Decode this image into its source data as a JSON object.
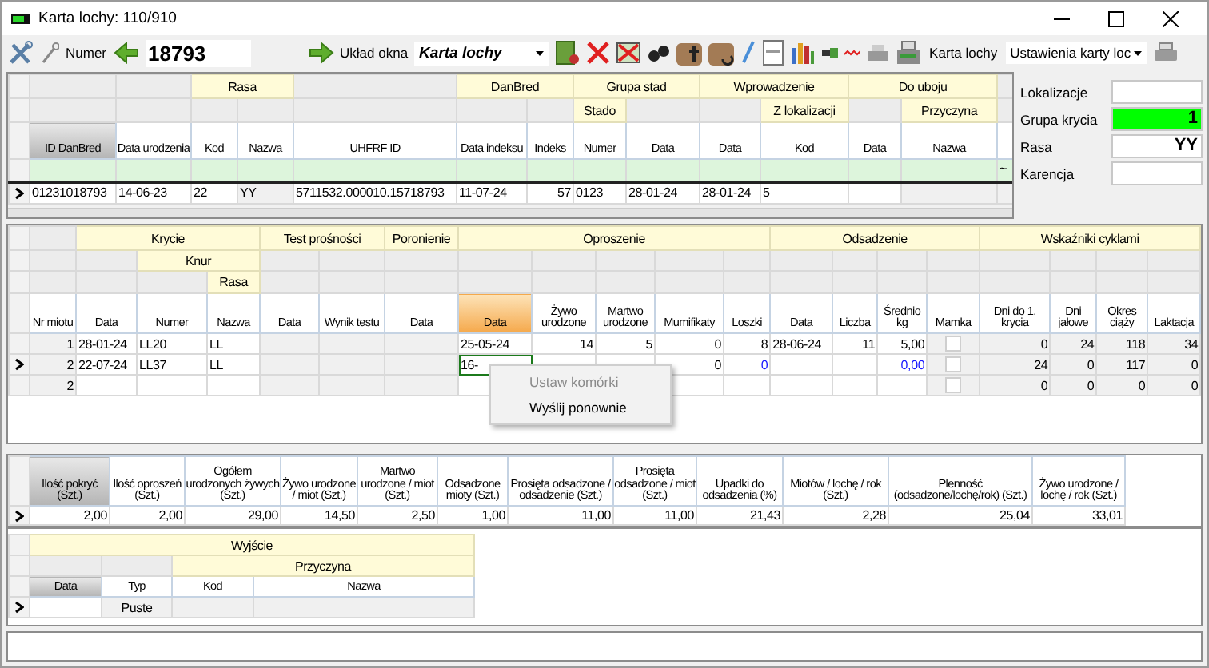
{
  "window": {
    "title": "Karta lochy: 110/910"
  },
  "toolbar": {
    "number_label": "Numer",
    "number": "18793",
    "layout_label": "Układ okna",
    "layout_value": "Karta lochy",
    "card_button": "Karta lochy",
    "settings_dropdown": "Ustawienia karty loc"
  },
  "top_grid": {
    "header_rows": [
      [
        null,
        null,
        {
          "label": "Rasa"
        },
        null,
        {
          "label": "DanBred"
        },
        {
          "label": "Grupa stad"
        },
        {
          "label": "Wprowadzenie"
        },
        {
          "label": "Do uboju"
        },
        null
      ],
      [
        null,
        null,
        null,
        null,
        null,
        null,
        null,
        {
          "label": "Stado"
        },
        null,
        null,
        {
          "label": "Z lokalizacji"
        },
        null,
        {
          "label": "Przyczyna"
        },
        null
      ]
    ],
    "columns": [
      {
        "label": "ID DanBred",
        "sorted": true,
        "editable": true
      },
      {
        "label": "Data urodzenia",
        "sorted": false,
        "editable": true
      },
      {
        "label": "Kod",
        "sorted": false,
        "editable": true
      },
      {
        "label": "Nazwa",
        "sorted": false,
        "editable": false
      },
      {
        "label": "UHFRF ID",
        "sorted": false,
        "editable": true
      },
      {
        "label": "Data indeksu",
        "sorted": false,
        "editable": true
      },
      {
        "label": "Indeks",
        "sorted": false,
        "editable": true
      },
      {
        "label": "Numer",
        "sorted": false,
        "editable": true
      },
      {
        "label": "Data",
        "sorted": false,
        "editable": true
      },
      {
        "label": "Data",
        "sorted": false,
        "editable": true
      },
      {
        "label": "Kod",
        "sorted": false,
        "editable": true
      },
      {
        "label": "Data",
        "sorted": false,
        "editable": true
      },
      {
        "label": "Nazwa",
        "sorted": false,
        "editable": false
      },
      {
        "sorted": false,
        "editable": false
      }
    ],
    "filter_row": {
      "marker": "~"
    },
    "rows": [
      {
        "current": true,
        "cells": [
          "01231018793",
          "14-06-23",
          "22",
          "YY",
          "5711532.000010.15718793",
          "11-07-24",
          "57",
          "0123",
          "28-01-24",
          "28-01-24",
          "5",
          null,
          null,
          null
        ]
      }
    ]
  },
  "side_panel": {
    "fields": [
      {
        "label": "Lokalizacje"
      },
      {
        "label": "Grupa krycia",
        "value": "1",
        "color": "#00ff00"
      },
      {
        "label": "Rasa",
        "value": "YY"
      },
      {
        "label": "Karencja"
      }
    ]
  },
  "litter_grid": {
    "header_rows": [
      [
        null,
        {
          "label": "Krycie"
        },
        {
          "label": "Test prośności"
        },
        {
          "label": "Poronienie"
        },
        {
          "label": "Oproszenie"
        },
        {
          "label": "Odsadzenie"
        },
        {
          "label": "Wskaźniki cyklami"
        }
      ],
      [
        null,
        null,
        {
          "label": "Knur"
        },
        null,
        null,
        null,
        null,
        null,
        null,
        null,
        null,
        null,
        null,
        null,
        null,
        null,
        null,
        null,
        null
      ],
      [
        null,
        null,
        null,
        {
          "label": "Rasa"
        },
        null,
        null,
        null,
        null,
        null,
        null,
        null,
        null,
        null,
        null,
        null,
        null,
        null,
        null,
        null,
        null
      ]
    ],
    "columns": [
      {
        "label": "Nr miotu",
        "sorted": false,
        "selected": false,
        "editable": false
      },
      {
        "label": "Data",
        "sorted": false,
        "selected": false,
        "editable": true
      },
      {
        "label": "Numer",
        "sorted": false,
        "selected": false,
        "editable": true
      },
      {
        "label": "Nazwa",
        "sorted": false,
        "selected": false,
        "editable": true
      },
      {
        "label": "Data",
        "sorted": false,
        "selected": false,
        "editable": false
      },
      {
        "label": "Wynik testu",
        "sorted": false,
        "selected": false,
        "editable": false
      },
      {
        "label": "Data",
        "sorted": false,
        "selected": false,
        "editable": false
      },
      {
        "label": "Data",
        "sorted": false,
        "selected": true,
        "editable": true
      },
      {
        "label": "Żywo urodzone",
        "sorted": false,
        "selected": false,
        "editable": true
      },
      {
        "label": "Martwo urodzone",
        "sorted": false,
        "selected": false,
        "editable": true
      },
      {
        "label": "Mumifikaty",
        "sorted": false,
        "selected": false,
        "editable": true
      },
      {
        "label": "Loszki",
        "sorted": false,
        "selected": false,
        "editable": true
      },
      {
        "label": "Data",
        "sorted": false,
        "selected": false,
        "editable": true
      },
      {
        "label": "Liczba",
        "sorted": false,
        "selected": false,
        "editable": true
      },
      {
        "label": "Średnio kg",
        "sorted": false,
        "selected": false,
        "editable": true
      },
      {
        "label": "Mamka",
        "sorted": false,
        "selected": false,
        "editable": false
      },
      {
        "label": "Dni do 1. krycia",
        "sorted": false,
        "selected": false,
        "editable": false
      },
      {
        "label": "Dni jałowe",
        "sorted": false,
        "selected": false,
        "editable": false
      },
      {
        "label": "Okres ciąży",
        "sorted": false,
        "selected": false,
        "editable": false
      },
      {
        "label": "Laktacja",
        "sorted": false,
        "selected": false,
        "editable": false
      }
    ],
    "rows": [
      {
        "current": false,
        "cells": [
          "1",
          "28-01-24",
          "LL20",
          "LL",
          null,
          null,
          null,
          "25-05-24",
          "14",
          "5",
          "0",
          "8",
          "28-06-24",
          "11",
          "5,00",
          {
            "kind": "checkbox",
            "checked": false
          },
          "0",
          "24",
          "118",
          "34"
        ]
      },
      {
        "current": true,
        "cells": [
          "2",
          "22-07-24",
          "LL37",
          "LL",
          null,
          null,
          null,
          {
            "kind": "editing",
            "text": "16-"
          },
          null,
          null,
          "0",
          {
            "kind": "calculated",
            "text": "0"
          },
          null,
          null,
          {
            "kind": "calculated",
            "text": "0,00"
          },
          {
            "kind": "checkbox",
            "checked": false
          },
          "24",
          "0",
          "117",
          "0"
        ]
      },
      {
        "current": false,
        "cells": [
          "2",
          null,
          null,
          null,
          null,
          null,
          null,
          null,
          null,
          null,
          null,
          null,
          null,
          null,
          null,
          {
            "kind": "checkbox",
            "checked": false
          },
          "0",
          "0",
          "0",
          "0"
        ]
      }
    ]
  },
  "context_menu": {
    "items": [
      {
        "label": "Ustaw komórki",
        "disabled": true
      },
      {
        "label": "Wyślij ponownie",
        "disabled": false
      }
    ]
  },
  "stats_grid": {
    "columns": [
      {
        "label": "Ilość pokryć (Szt.)",
        "sorted": true
      },
      {
        "label": "Ilość oproszeń (Szt.)",
        "sorted": false
      },
      {
        "label": "Ogółem urodzonych żywych (Szt.)",
        "sorted": false
      },
      {
        "label": "Żywo urodzone / miot (Szt.)",
        "sorted": false
      },
      {
        "label": "Martwo urodzone / miot (Szt.)",
        "sorted": false
      },
      {
        "label": "Odsadzone mioty (Szt.)",
        "sorted": false
      },
      {
        "label": "Prosięta odsadzone / odsadzenie (Szt.)",
        "sorted": false
      },
      {
        "label": "Prosięta odsadzone / miot (Szt.)",
        "sorted": false
      },
      {
        "label": "Upadki do odsadzenia (%)",
        "sorted": false
      },
      {
        "label": "Miotów / lochę / rok (Szt.)",
        "sorted": false
      },
      {
        "label": "Plenność (odsadzone/lochę/rok) (Szt.)",
        "sorted": false
      },
      {
        "label": "Żywo urodzone / lochę / rok (Szt.)",
        "sorted": false
      }
    ],
    "rows": [
      {
        "current": true,
        "cells": [
          "2,00",
          "2,00",
          "29,00",
          "14,50",
          "2,50",
          "1,00",
          "11,00",
          "11,00",
          "21,43",
          "2,28",
          "25,04",
          "33,01"
        ]
      }
    ]
  },
  "exit_grid": {
    "header_rows": [
      [
        {
          "label": "Wyjście"
        }
      ],
      [
        null,
        null,
        {
          "label": "Przyczyna"
        }
      ]
    ],
    "columns": [
      {
        "label": "Data",
        "sorted": true,
        "editable": true
      },
      {
        "label": "Typ",
        "sorted": false,
        "editable": false
      },
      {
        "label": "Kod",
        "sorted": false,
        "editable": false
      },
      {
        "label": "Nazwa",
        "sorted": false,
        "editable": false
      }
    ],
    "rows": [
      {
        "current": true,
        "cells": [
          null,
          "Puste",
          null,
          null
        ]
      }
    ]
  }
}
